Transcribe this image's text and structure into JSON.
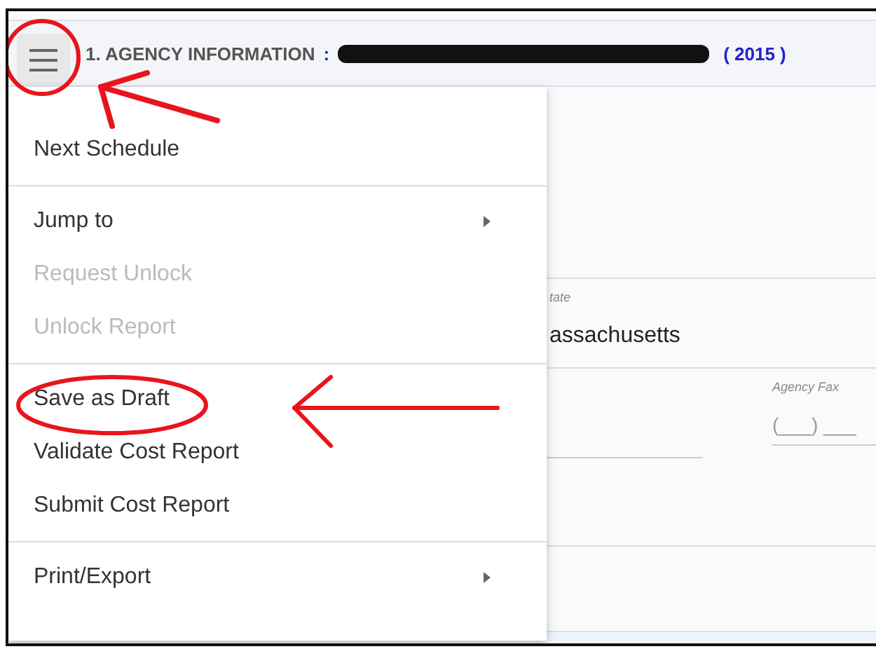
{
  "header": {
    "title": "1. AGENCY INFORMATION",
    "separator": ":",
    "year": "( 2015 )"
  },
  "form": {
    "state_label": "tate",
    "state_value": "assachusetts",
    "fax_label": "Agency Fax",
    "fax_value": "(___) ___"
  },
  "menu": {
    "groups": [
      [
        {
          "label": "Next Schedule",
          "disabled": false,
          "submenu": false
        }
      ],
      [
        {
          "label": "Jump to",
          "disabled": false,
          "submenu": true
        },
        {
          "label": "Request Unlock",
          "disabled": true,
          "submenu": false
        },
        {
          "label": "Unlock Report",
          "disabled": true,
          "submenu": false
        }
      ],
      [
        {
          "label": "Save as Draft",
          "disabled": false,
          "submenu": false
        },
        {
          "label": "Validate Cost Report",
          "disabled": false,
          "submenu": false
        },
        {
          "label": "Submit Cost Report",
          "disabled": false,
          "submenu": false
        }
      ],
      [
        {
          "label": "Print/Export",
          "disabled": false,
          "submenu": true
        }
      ]
    ]
  }
}
